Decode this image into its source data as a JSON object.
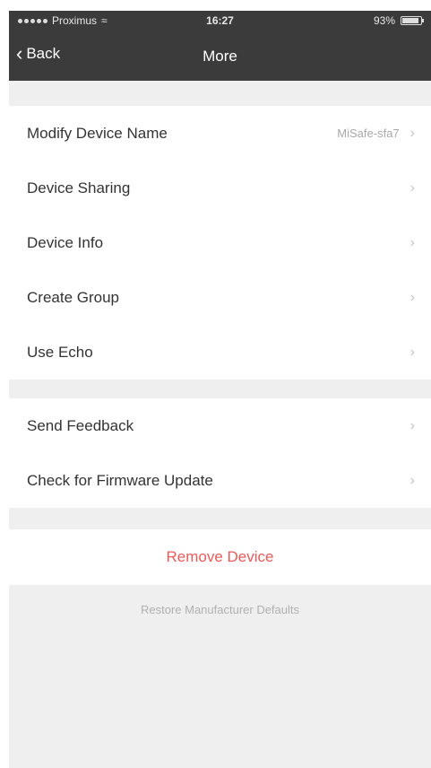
{
  "status_bar": {
    "carrier": "Proximus",
    "time": "16:27",
    "battery": "93%"
  },
  "navbar": {
    "back_label": "Back",
    "title": "More"
  },
  "group1": [
    {
      "label": "Modify Device Name",
      "value": "MiSafe-sfa7"
    },
    {
      "label": "Device Sharing",
      "value": ""
    },
    {
      "label": "Device Info",
      "value": ""
    },
    {
      "label": "Create Group",
      "value": ""
    },
    {
      "label": "Use Echo",
      "value": ""
    }
  ],
  "group2": [
    {
      "label": "Send Feedback"
    },
    {
      "label": "Check for Firmware Update"
    }
  ],
  "remove_device": "Remove Device",
  "restore_defaults": "Restore Manufacturer Defaults",
  "colors": {
    "header_bg": "#3b3b3b",
    "page_bg": "#efefef",
    "destructive": "#e85b5b"
  }
}
